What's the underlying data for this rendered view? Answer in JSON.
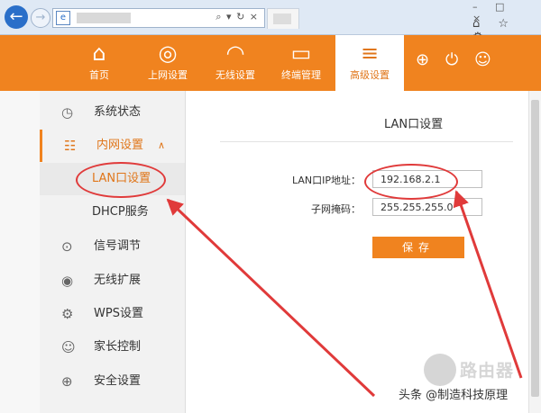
{
  "browser": {
    "address_controls": "⌕ ▾ ↻ ×",
    "window_buttons": "– □ ×",
    "tool_icons": "⌂ ☆ ⚙"
  },
  "header": {
    "nav": [
      {
        "label": "首页",
        "icon": "home-icon"
      },
      {
        "label": "上网设置",
        "icon": "globe-icon"
      },
      {
        "label": "无线设置",
        "icon": "wifi-icon"
      },
      {
        "label": "终端管理",
        "icon": "devices-icon"
      },
      {
        "label": "高级设置",
        "icon": "sliders-icon",
        "active": true
      }
    ],
    "accent_color": "#f0831f"
  },
  "sidebar": {
    "items": [
      {
        "label": "系统状态",
        "icon": "clock-icon"
      },
      {
        "label": "内网设置",
        "icon": "network-icon",
        "expanded": true
      },
      {
        "label": "LAN口设置",
        "sub": true,
        "active": true
      },
      {
        "label": "DHCP服务",
        "sub": true
      },
      {
        "label": "信号调节",
        "icon": "signal-icon"
      },
      {
        "label": "无线扩展",
        "icon": "repeater-icon"
      },
      {
        "label": "WPS设置",
        "icon": "gear-icon"
      },
      {
        "label": "家长控制",
        "icon": "user-icon"
      },
      {
        "label": "安全设置",
        "icon": "shield-icon"
      }
    ]
  },
  "main": {
    "title": "LAN口设置",
    "fields": [
      {
        "label": "LAN口IP地址：",
        "value": "192.168.2.1"
      },
      {
        "label": "子网掩码：",
        "value": "255.255.255.0"
      }
    ],
    "save_label": "保存"
  },
  "watermark": {
    "brand": "路由器",
    "caption": "头条 @制造科技原理"
  },
  "annotation_color": "#e03a3a"
}
